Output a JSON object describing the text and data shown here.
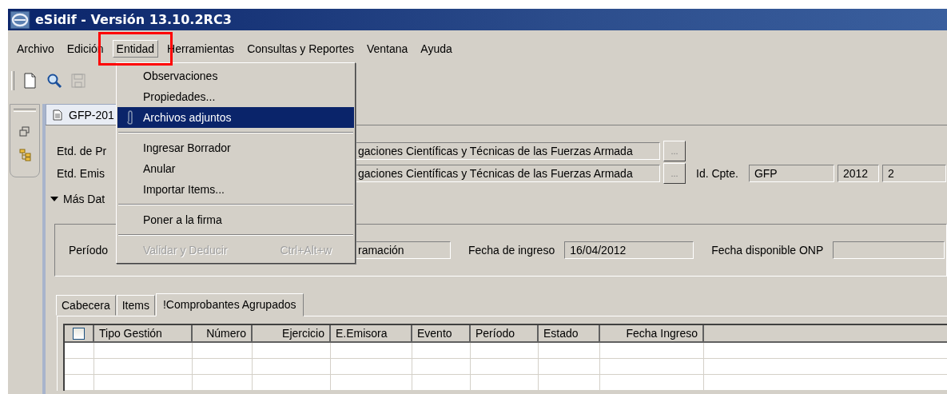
{
  "window": {
    "title": "eSidif - Versión 13.10.2RC3"
  },
  "menu_bar": [
    {
      "label": "Archivo",
      "selected": false
    },
    {
      "label": "Edición",
      "selected": false
    },
    {
      "label": "Entidad",
      "selected": true
    },
    {
      "label": "Herramientas",
      "selected": false
    },
    {
      "label": "Consultas y Reportes",
      "selected": false
    },
    {
      "label": "Ventana",
      "selected": false
    },
    {
      "label": "Ayuda",
      "selected": false
    }
  ],
  "annotation": {
    "kind": "frame"
  },
  "menu": [
    {
      "kind": "item",
      "label": "Observaciones",
      "selected": false,
      "disabled": false
    },
    {
      "kind": "item",
      "label": "Propiedades...",
      "selected": false,
      "disabled": false
    },
    {
      "kind": "icon_item",
      "label": "Archivos adjuntos",
      "selected": true,
      "disabled": false
    },
    {
      "kind": "separator"
    },
    {
      "kind": "item",
      "label": "Ingresar Borrador",
      "selected": false,
      "disabled": false
    },
    {
      "kind": "item",
      "label": "Anular",
      "selected": false,
      "disabled": false
    },
    {
      "kind": "item",
      "label": "Importar Items...",
      "selected": false,
      "disabled": false
    },
    {
      "kind": "separator"
    },
    {
      "kind": "item",
      "label": "Poner a la firma",
      "selected": false,
      "disabled": false
    },
    {
      "kind": "separator"
    },
    {
      "kind": "item",
      "label": "Validar y Deducir",
      "shortcut": "Ctrl+Alt+w",
      "selected": false,
      "disabled": true
    }
  ],
  "toolbar": [
    {
      "kind": "new",
      "disabled": false
    },
    {
      "kind": "search",
      "disabled": false
    },
    {
      "kind": "save",
      "disabled": true
    }
  ],
  "sidebar": [
    {
      "kind": "restore"
    },
    {
      "kind": "tree"
    }
  ],
  "document_tabs": [
    {
      "label": "GFP-201",
      "selected": true
    }
  ],
  "form": {
    "fields": [
      {
        "label": "Etd. de Pr",
        "value": "gaciones Científicas y Técnicas de las Fuerzas Armada",
        "button": "..."
      },
      {
        "label": "Etd. Emis",
        "value": "gaciones Científicas y Técnicas de las Fuerzas Armada",
        "button": "..."
      }
    ],
    "id": {
      "label": "Id. Cpte.",
      "values": [
        "GFP",
        "2012",
        "2"
      ]
    },
    "more_data": {
      "label": "Más Dat",
      "expanded": true
    },
    "group": [
      {
        "label": "Período",
        "value": "ramación"
      },
      {
        "label": "Fecha de ingreso",
        "value": "16/04/2012"
      },
      {
        "label": "Fecha disponible ONP"
      }
    ]
  },
  "tabs": [
    {
      "label": "Cabecera",
      "selected": false
    },
    {
      "label": "Items",
      "selected": false
    },
    {
      "label": "!Comprobantes Agrupados",
      "selected": true
    }
  ],
  "table": {
    "select_all": {
      "checked": false
    },
    "columns": [
      "Tipo Gestión",
      "Número",
      "Ejercicio",
      "E.Emisora",
      "Evento",
      "Período",
      "Estado",
      "Fecha Ingreso"
    ]
  }
}
